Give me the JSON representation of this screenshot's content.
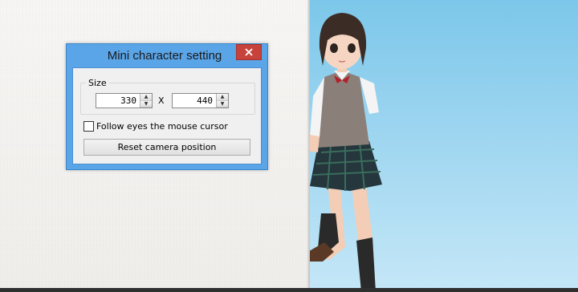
{
  "dialog": {
    "title": "Mini character setting",
    "close_glyph": "✕",
    "size_group_label": "Size",
    "width_value": "330",
    "height_value": "440",
    "separator": "X",
    "follow_eyes_label": "Follow eyes the mouse cursor",
    "follow_eyes_checked": false,
    "reset_camera_label": "Reset camera position"
  },
  "colors": {
    "titlebar": "#5aa5e8",
    "close_button": "#c7423a",
    "sky_top": "#7cc7ea",
    "sky_bottom": "#c5e7f7"
  }
}
